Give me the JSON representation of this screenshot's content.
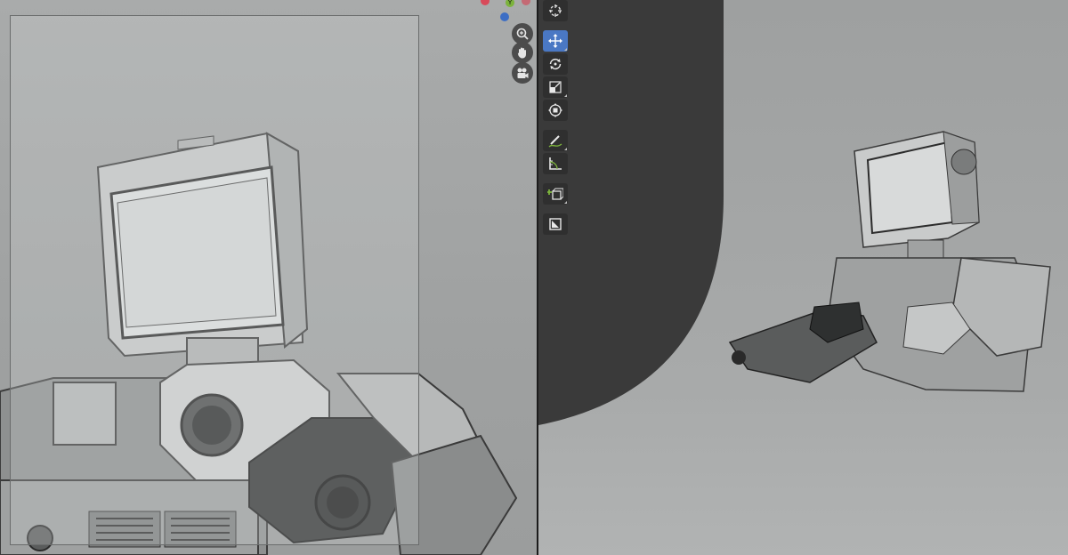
{
  "viewports": {
    "left": {
      "name": "camera-view",
      "frame_visible": true
    },
    "right": {
      "name": "perspective-view"
    }
  },
  "navigation": {
    "gizmo_axis_label": "Y",
    "buttons": [
      {
        "name": "zoom-icon"
      },
      {
        "name": "hand-pan-icon"
      },
      {
        "name": "camera-icon"
      }
    ]
  },
  "toolbar": {
    "tools": [
      {
        "name": "cursor-tool",
        "icon": "crosshair-circle-icon",
        "active": false
      },
      {
        "name": "move-tool",
        "icon": "move-arrows-icon",
        "active": true
      },
      {
        "name": "rotate-tool",
        "icon": "rotate-icon",
        "active": false
      },
      {
        "name": "scale-tool",
        "icon": "scale-icon",
        "active": false
      },
      {
        "name": "transform-tool",
        "icon": "transform-icon",
        "active": false
      },
      {
        "name": "annotate-tool",
        "icon": "annotate-pencil-icon",
        "active": false
      },
      {
        "name": "measure-tool",
        "icon": "ruler-measure-icon",
        "active": false
      },
      {
        "name": "add-cube-tool",
        "icon": "add-cube-icon",
        "active": false
      },
      {
        "name": "extra-tool",
        "icon": "shape-icon",
        "active": false
      }
    ]
  },
  "colors": {
    "active_tool": "#4a78c4",
    "axis_x": "#d84a5a",
    "axis_y": "#7cb33c",
    "axis_z": "#3d6ec4",
    "toolbar_bg": "#2f2f2f"
  }
}
